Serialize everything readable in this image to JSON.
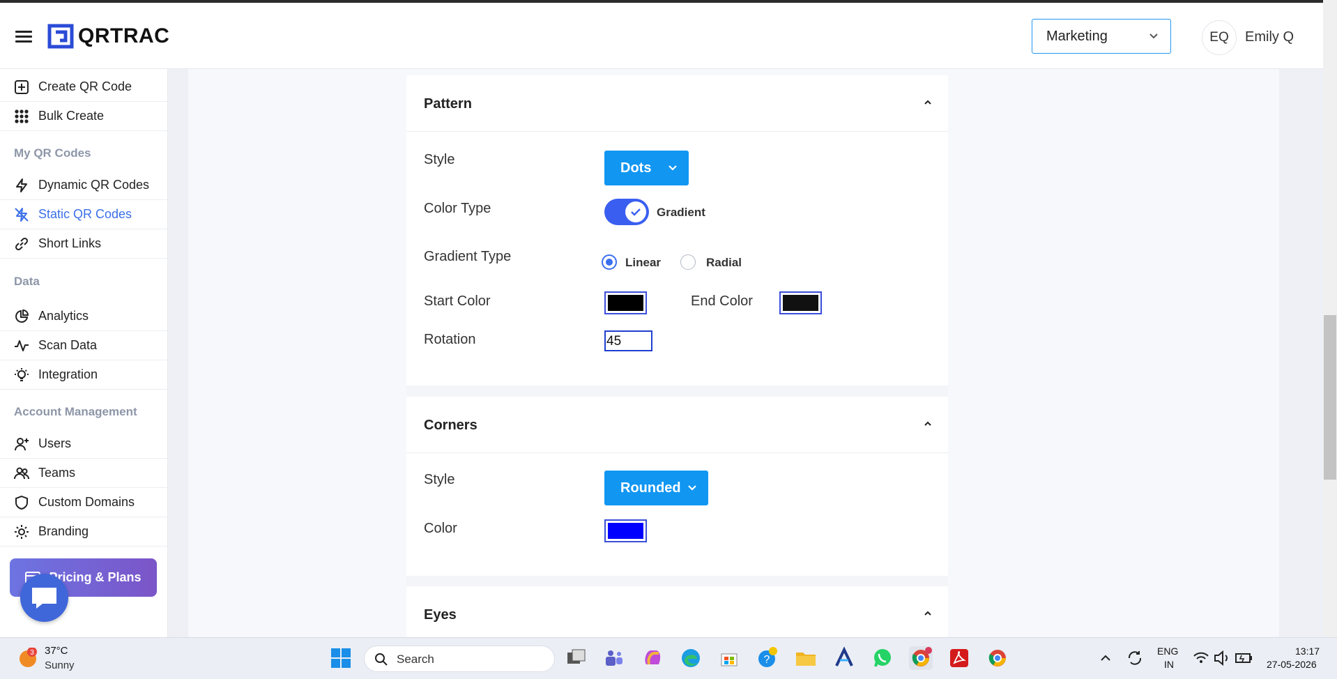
{
  "app": {
    "name": "QRTRAC"
  },
  "header": {
    "department_select": "Marketing",
    "user_initials": "EQ",
    "user_name": "Emily Q"
  },
  "sidebar": {
    "items_top": [
      {
        "label": "Create QR Code",
        "icon": "plus-square-icon"
      },
      {
        "label": "Bulk Create",
        "icon": "grid-dots-icon"
      }
    ],
    "section_my_qr": "My QR Codes",
    "items_qr": [
      {
        "label": "Dynamic QR Codes",
        "icon": "lightning-icon"
      },
      {
        "label": "Static QR Codes",
        "icon": "lightning-off-icon",
        "active": true
      },
      {
        "label": "Short Links",
        "icon": "link-icon"
      }
    ],
    "section_data": "Data",
    "items_data": [
      {
        "label": "Analytics",
        "icon": "pie-chart-icon"
      },
      {
        "label": "Scan Data",
        "icon": "activity-icon"
      },
      {
        "label": "Integration",
        "icon": "bulb-icon"
      }
    ],
    "section_account": "Account Management",
    "items_account": [
      {
        "label": "Users",
        "icon": "user-plus-icon"
      },
      {
        "label": "Teams",
        "icon": "users-icon"
      },
      {
        "label": "Custom Domains",
        "icon": "shield-icon"
      },
      {
        "label": "Branding",
        "icon": "sun-icon"
      }
    ],
    "pricing": "Pricing & Plans"
  },
  "pattern": {
    "title": "Pattern",
    "style_label": "Style",
    "style_value": "Dots",
    "color_type_label": "Color Type",
    "color_type_value": "Gradient",
    "gradient_type_label": "Gradient Type",
    "gradient_options": [
      "Linear",
      "Radial"
    ],
    "gradient_selected": "Linear",
    "start_color_label": "Start Color",
    "start_color": "#000000",
    "end_color_label": "End Color",
    "end_color": "#111111",
    "rotation_label": "Rotation",
    "rotation_value": "45"
  },
  "corners": {
    "title": "Corners",
    "style_label": "Style",
    "style_value": "Rounded",
    "color_label": "Color",
    "color": "#0000ff"
  },
  "eyes": {
    "title": "Eyes"
  },
  "taskbar": {
    "weather_badge": "3",
    "temperature": "37°C",
    "condition": "Sunny",
    "search_label": "Search",
    "lang_line1": "ENG",
    "lang_line2": "IN",
    "time": "13:17",
    "date": "27-05-2026"
  },
  "colors": {
    "accent": "#1196f2",
    "toggle": "#3a5ff0",
    "active_nav": "#3a6fe8"
  }
}
